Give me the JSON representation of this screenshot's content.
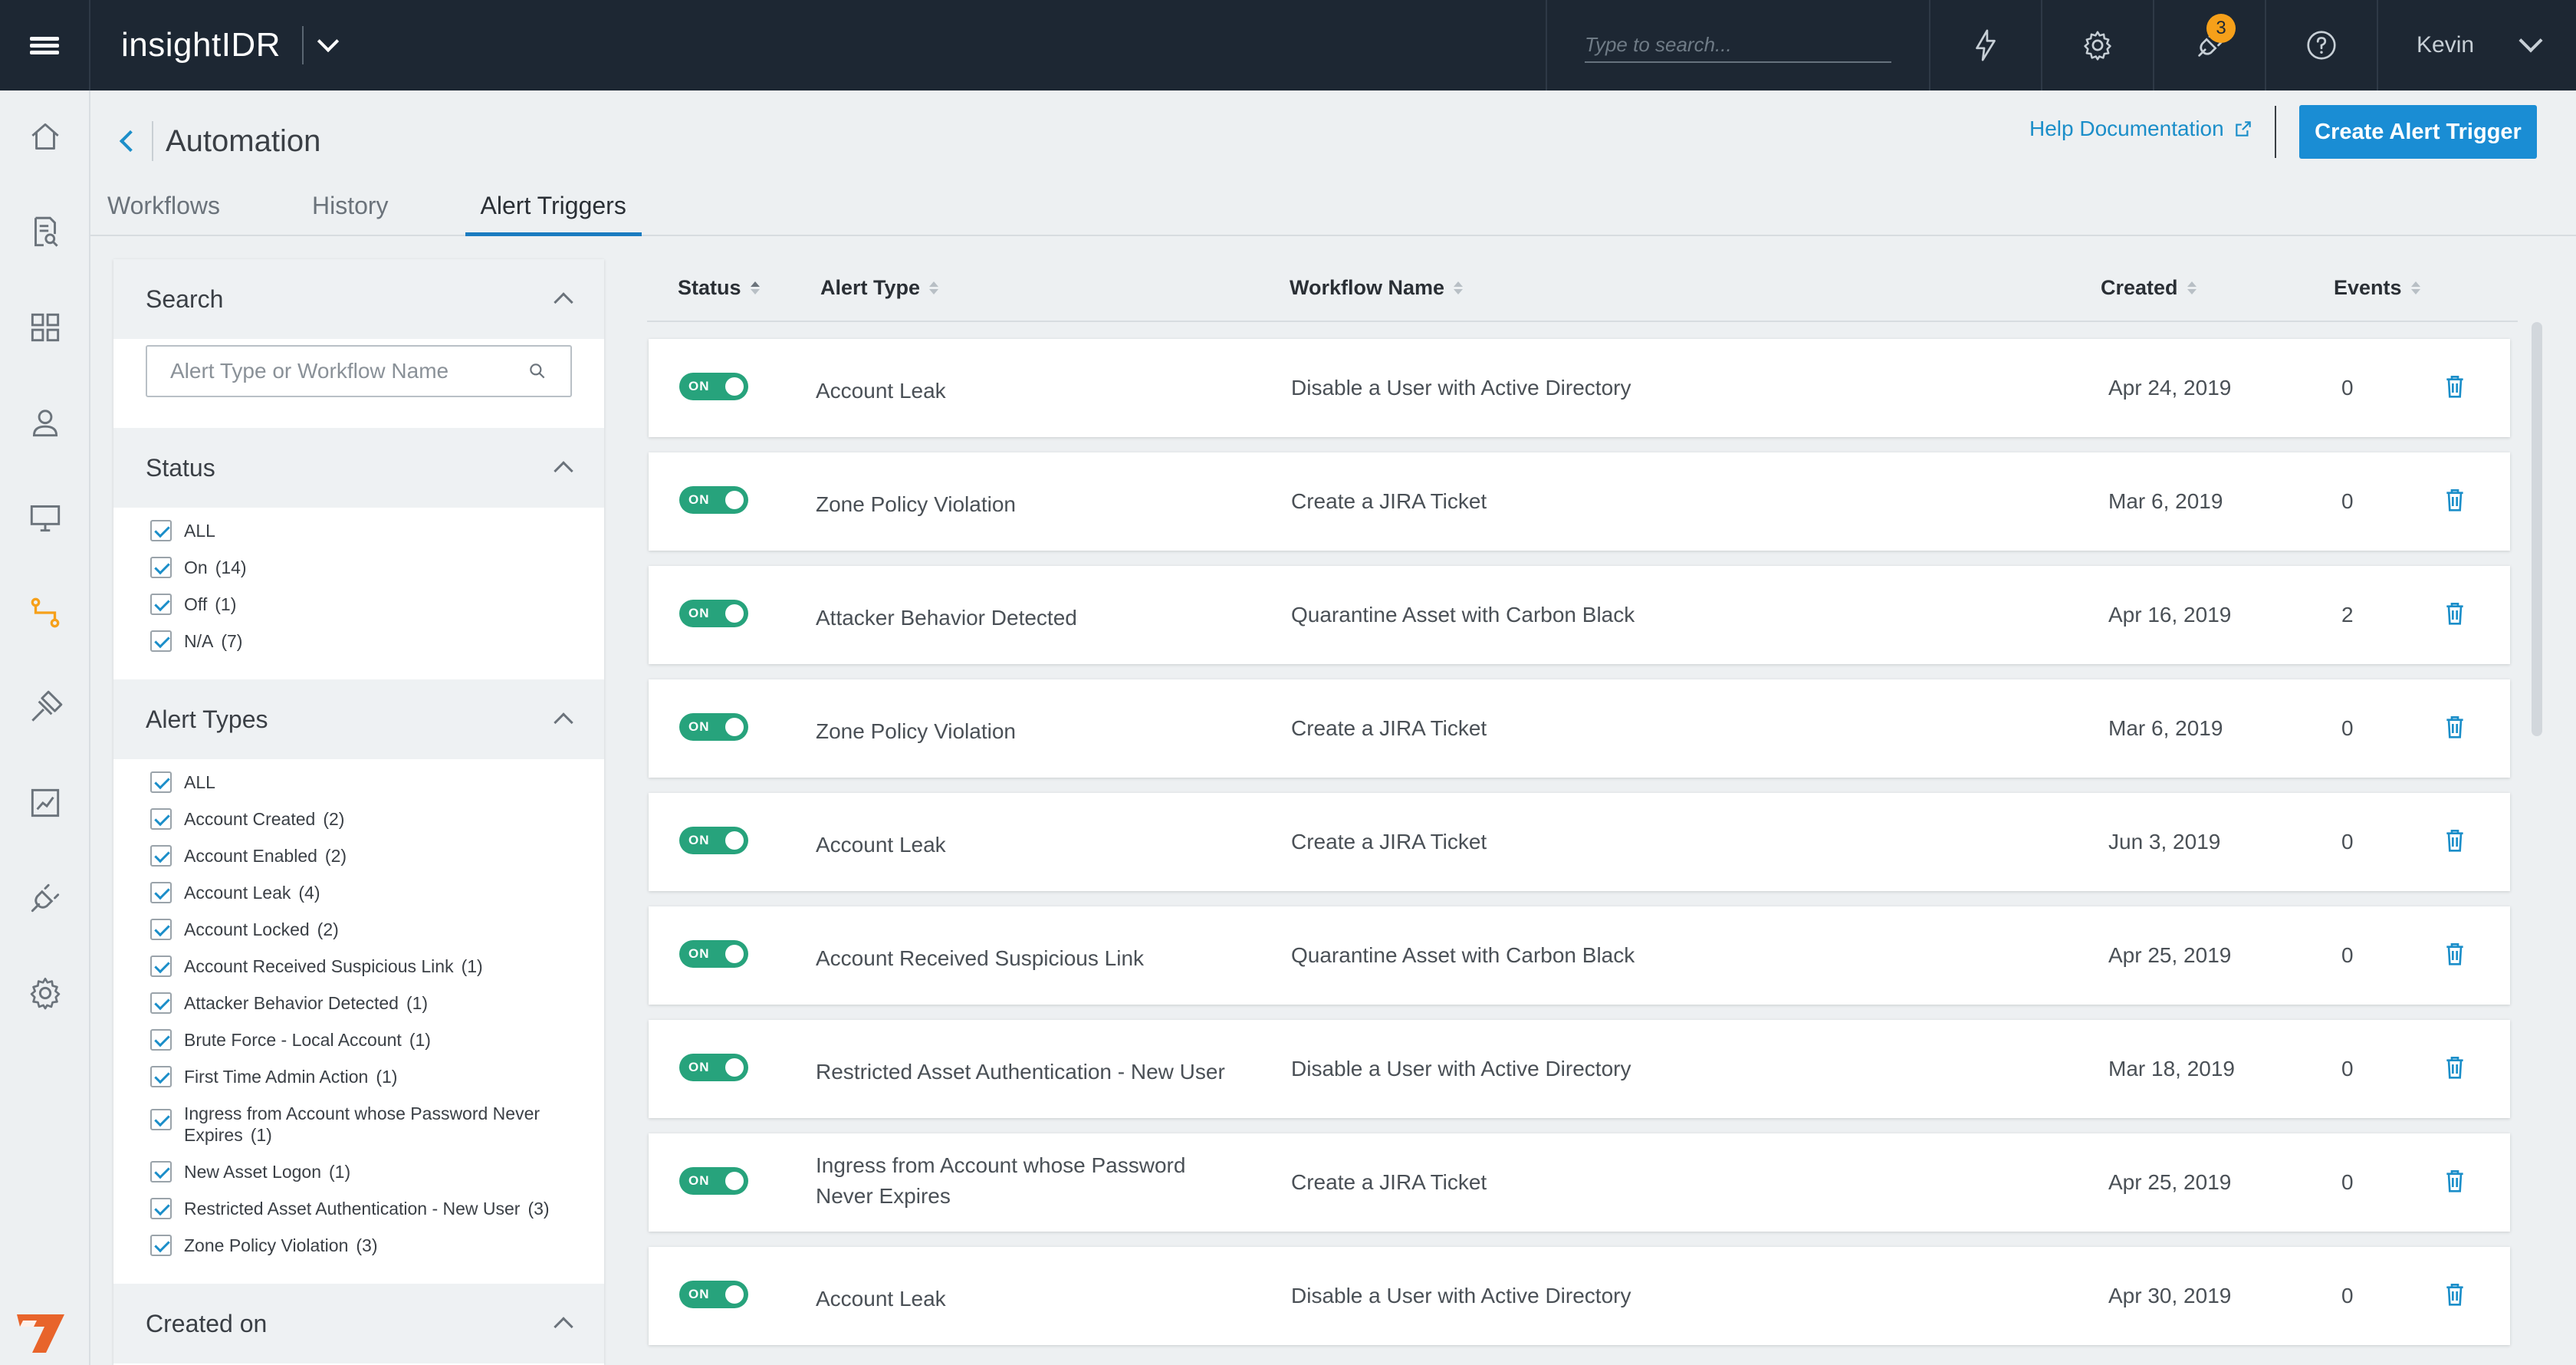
{
  "app": {
    "name": "insightIDR"
  },
  "topbar": {
    "search_placeholder": "Type to search...",
    "notifications_count": "3",
    "user_name": "Kevin"
  },
  "page": {
    "title": "Automation",
    "help_label": "Help Documentation",
    "create_label": "Create Alert Trigger"
  },
  "tabs": [
    {
      "label": "Workflows"
    },
    {
      "label": "History"
    },
    {
      "label": "Alert Triggers"
    }
  ],
  "filters": {
    "search": {
      "title": "Search",
      "placeholder": "Alert Type or Workflow Name"
    },
    "status": {
      "title": "Status",
      "items": [
        {
          "label": "ALL",
          "count": ""
        },
        {
          "label": "On",
          "count": "(14)"
        },
        {
          "label": "Off",
          "count": "(1)"
        },
        {
          "label": "N/A",
          "count": "(7)"
        }
      ]
    },
    "alert_types": {
      "title": "Alert Types",
      "items": [
        {
          "label": "ALL",
          "count": ""
        },
        {
          "label": "Account Created",
          "count": "(2)"
        },
        {
          "label": "Account Enabled",
          "count": "(2)"
        },
        {
          "label": "Account Leak",
          "count": "(4)"
        },
        {
          "label": "Account Locked",
          "count": "(2)"
        },
        {
          "label": "Account Received Suspicious Link",
          "count": "(1)"
        },
        {
          "label": "Attacker Behavior Detected",
          "count": "(1)"
        },
        {
          "label": "Brute Force - Local Account",
          "count": "(1)"
        },
        {
          "label": "First Time Admin Action",
          "count": "(1)"
        },
        {
          "label": "Ingress from Account whose Password Never Expires",
          "count": "(1)"
        },
        {
          "label": "New Asset Logon",
          "count": "(1)"
        },
        {
          "label": "Restricted Asset Authentication - New User",
          "count": "(3)"
        },
        {
          "label": "Zone Policy Violation",
          "count": "(3)"
        }
      ]
    },
    "created_on": {
      "title": "Created on"
    }
  },
  "table": {
    "columns": [
      "Status",
      "Alert Type",
      "Workflow Name",
      "Created",
      "Events"
    ],
    "rows": [
      {
        "status": "ON",
        "alert_type": "Account Leak",
        "workflow": "Disable a User with Active Directory",
        "created": "Apr 24, 2019",
        "events": "0"
      },
      {
        "status": "ON",
        "alert_type": "Zone Policy Violation",
        "workflow": "Create a JIRA Ticket",
        "created": "Mar 6, 2019",
        "events": "0"
      },
      {
        "status": "ON",
        "alert_type": "Attacker Behavior Detected",
        "workflow": "Quarantine Asset with Carbon Black",
        "created": "Apr 16, 2019",
        "events": "2"
      },
      {
        "status": "ON",
        "alert_type": "Zone Policy Violation",
        "workflow": "Create a JIRA Ticket",
        "created": "Mar 6, 2019",
        "events": "0"
      },
      {
        "status": "ON",
        "alert_type": "Account Leak",
        "workflow": "Create a JIRA Ticket",
        "created": "Jun 3, 2019",
        "events": "0"
      },
      {
        "status": "ON",
        "alert_type": "Account Received Suspicious Link",
        "workflow": "Quarantine Asset with Carbon Black",
        "created": "Apr 25, 2019",
        "events": "0"
      },
      {
        "status": "ON",
        "alert_type": "Restricted Asset Authentication - New User",
        "workflow": "Disable a User with Active Directory",
        "created": "Mar 18, 2019",
        "events": "0"
      },
      {
        "status": "ON",
        "alert_type": "Ingress from Account whose Password Never Expires",
        "workflow": "Create a JIRA Ticket",
        "created": "Apr 25, 2019",
        "events": "0"
      },
      {
        "status": "ON",
        "alert_type": "Account Leak",
        "workflow": "Disable a User with Active Directory",
        "created": "Apr 30, 2019",
        "events": "0"
      }
    ]
  },
  "colors": {
    "topbar": "#1d2733",
    "accent": "#1a8dd4",
    "toggle_on": "#27a37c",
    "badge": "#f6a01a",
    "active_nav": "#f6a01a"
  },
  "nav_icons": [
    "home-icon",
    "search-log-icon",
    "dashboard-icon",
    "user-icon",
    "monitor-icon",
    "automation-icon",
    "tools-icon",
    "chart-icon",
    "plug-icon",
    "settings-icon"
  ]
}
